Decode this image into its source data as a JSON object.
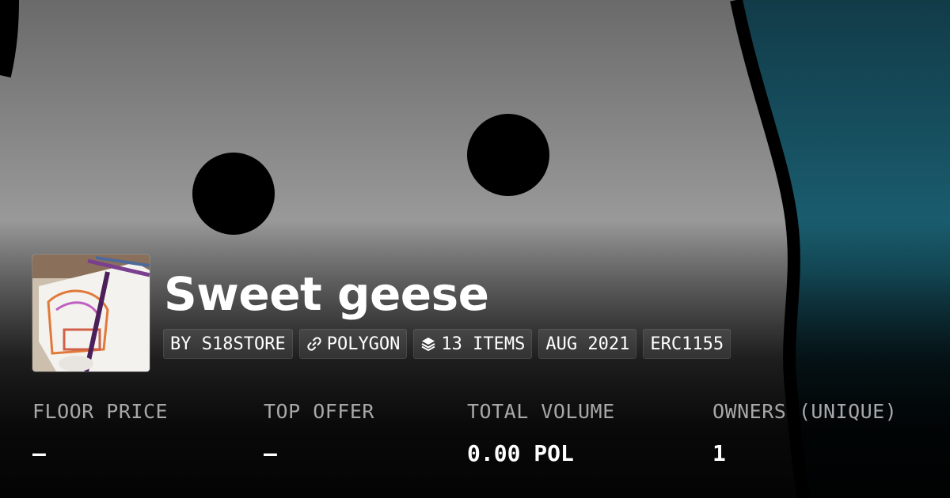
{
  "collection": {
    "title": "Sweet geese"
  },
  "tags": [
    {
      "label": "BY S18STORE",
      "icon": ""
    },
    {
      "label": "POLYGON",
      "icon": "polygon-link-icon"
    },
    {
      "label": "13 ITEMS",
      "icon": "layers-icon"
    },
    {
      "label": "AUG 2021",
      "icon": ""
    },
    {
      "label": "ERC1155",
      "icon": ""
    }
  ],
  "stats": [
    {
      "label": "FLOOR PRICE",
      "value": "–"
    },
    {
      "label": "TOP OFFER",
      "value": "–"
    },
    {
      "label": "TOTAL VOLUME",
      "value": "0.00 POL"
    },
    {
      "label": "OWNERS (UNIQUE)",
      "value": "1"
    }
  ],
  "colors": {
    "banner_gray": "#9a9a9a",
    "banner_teal": "#1a5f72",
    "text_primary": "#ffffff",
    "text_muted": "#a8a8a8"
  }
}
